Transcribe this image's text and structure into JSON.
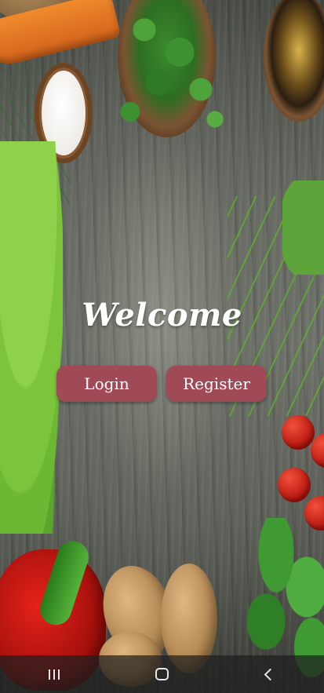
{
  "screen": {
    "welcome_text": "Welcome"
  },
  "actions": {
    "login_label": "Login",
    "register_label": "Register",
    "button_color": "#a14a57"
  },
  "navbar": {
    "icons": [
      "recents-icon",
      "home-icon",
      "back-icon"
    ]
  }
}
